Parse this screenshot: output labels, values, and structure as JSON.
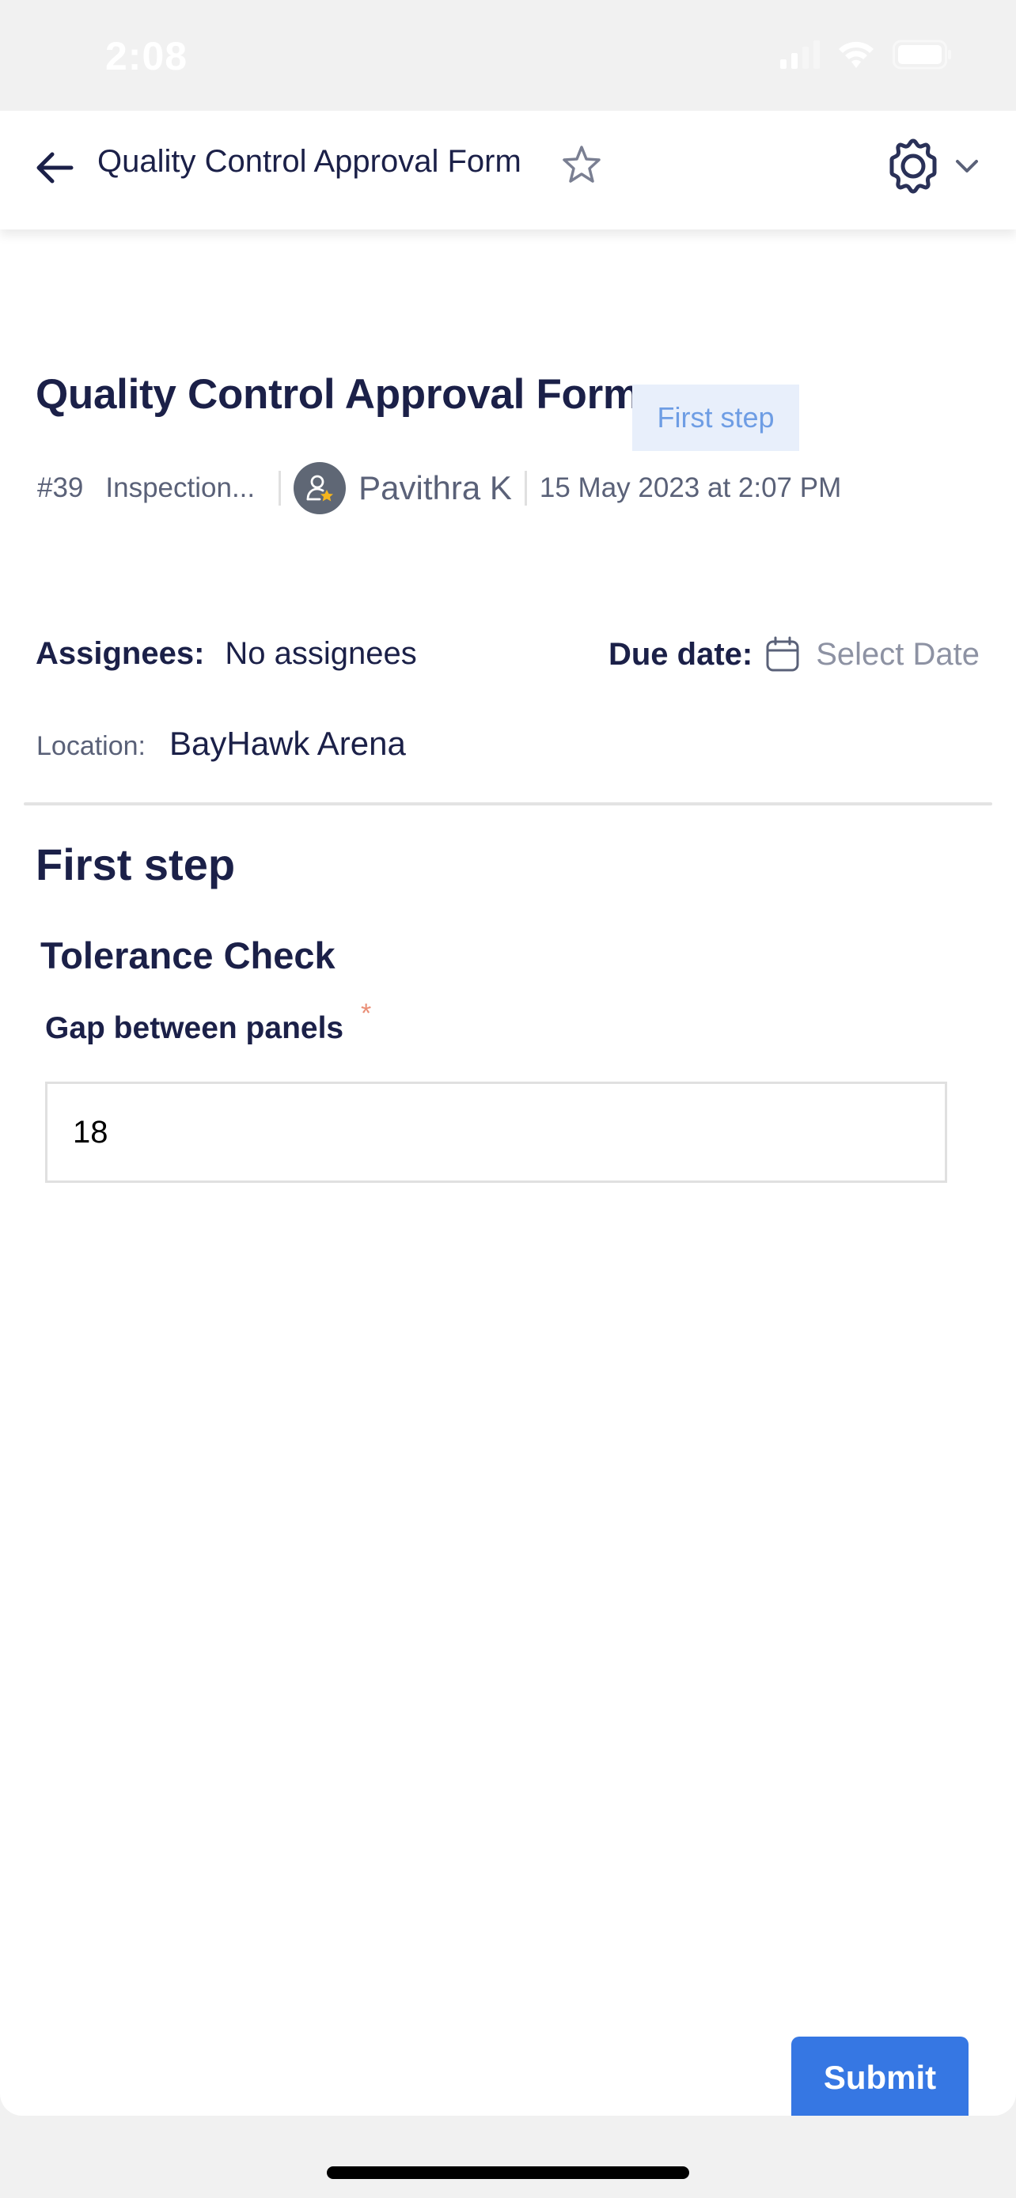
{
  "status_bar": {
    "time": "2:08"
  },
  "header": {
    "title": "Quality Control Approval Form",
    "icons": {
      "back": "arrow-left-icon",
      "favorite": "star-outline-icon",
      "settings": "gear-icon",
      "menu": "chevron-down-icon"
    }
  },
  "form": {
    "title": "Quality Control Approval Form",
    "step_badge": "First step",
    "meta": {
      "id": "#39",
      "type": "Inspection...",
      "author": "Pavithra K",
      "created": "15 May 2023 at 2:07 PM"
    },
    "assignees": {
      "label": "Assignees:",
      "value": "No assignees"
    },
    "due_date": {
      "label": "Due date:",
      "placeholder": "Select Date"
    },
    "location": {
      "label": "Location:",
      "value": "BayHawk Arena"
    }
  },
  "step": {
    "heading": "First step",
    "section": "Tolerance Check",
    "fields": [
      {
        "label": "Gap between panels",
        "required_mark": "*",
        "value": "18"
      }
    ]
  },
  "actions": {
    "submit_label": "Submit"
  },
  "colors": {
    "primary": "#3677e3",
    "text_dark": "#1b2048",
    "text_muted": "#5a6178",
    "badge_bg": "#e8effb",
    "badge_text": "#6e9de4",
    "required": "#ea8e76"
  }
}
